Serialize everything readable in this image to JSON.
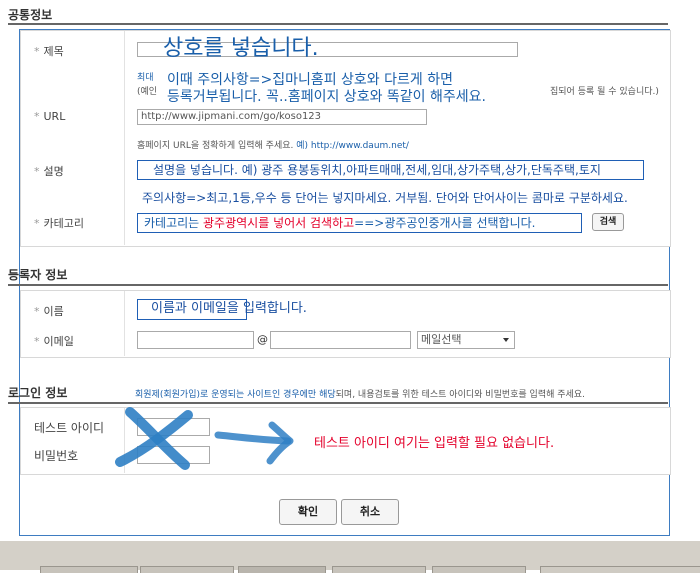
{
  "sections": {
    "common": "공통정보",
    "registrant": "등록자 정보",
    "login": "로그인 정보"
  },
  "fields": {
    "title": "제목",
    "url": "URL",
    "desc": "설명",
    "category": "카테고리",
    "name": "이름",
    "email": "이메일",
    "test_id": "테스트 아이디",
    "password": "비밀번호"
  },
  "hints": {
    "title_prefix_a": "최대",
    "title_prefix_b": "(예인",
    "title_suffix": "집되어 등록 될 수 있습니다.)",
    "url_help": "홈페이지 URL을 정확하게 입력해 주세요.",
    "url_example": "예) http://www.daum.net/",
    "login_notice_blue": "회원제(회원가입)로 운영되는 사이트인 경우에만 해당",
    "login_notice_rest": "되며, 내용검토를 위한 테스트 아이디와 비밀번호를 입력해 주세요."
  },
  "inputs": {
    "url_value": "http://www.jipmani.com/go/koso123",
    "email_at": "@",
    "email_select": "메일선택"
  },
  "buttons": {
    "search": "검색",
    "confirm": "확인",
    "cancel": "취소"
  },
  "annotations": {
    "title_main": "상호를 넣습니다.",
    "title_note1": "이때 주의사항=>집마니홈피 상호와 다르게 하면",
    "title_note2": "등록거부됩니다. 꼭..홈페이지 상호와 똑같이 해주세요.",
    "desc_main": "설명을 넣습니다. 예) 광주 용봉동위치,아파트매매,전세,임대,상가주택,상가,단독주택,토지",
    "desc_note": "주의사항=>최고,1등,우수 등 단어는 넣지마세요. 거부됨. 단어와 단어사이는 콤마로 구분하세요.",
    "cat_a": "카테고리는 ",
    "cat_b": "광주광역시를 넣어서 검색하고",
    "cat_c": "==>광주공인중개사를 선택합니다.",
    "name_email": "이름과 이메일을 입력합니다.",
    "login_red": "테스트 아이디 여기는 입력할 필요 없습니다."
  },
  "colors": {
    "annotation_blue": "#1a4fa0",
    "annotation_red": "#e4002b",
    "brush_blue": "#2f7fc4",
    "outline_blue": "#3e7cc1"
  },
  "icons": {
    "x_mark": "x-mark-icon",
    "arrow": "arrow-right-icon",
    "dropdown": "chevron-down-icon"
  }
}
